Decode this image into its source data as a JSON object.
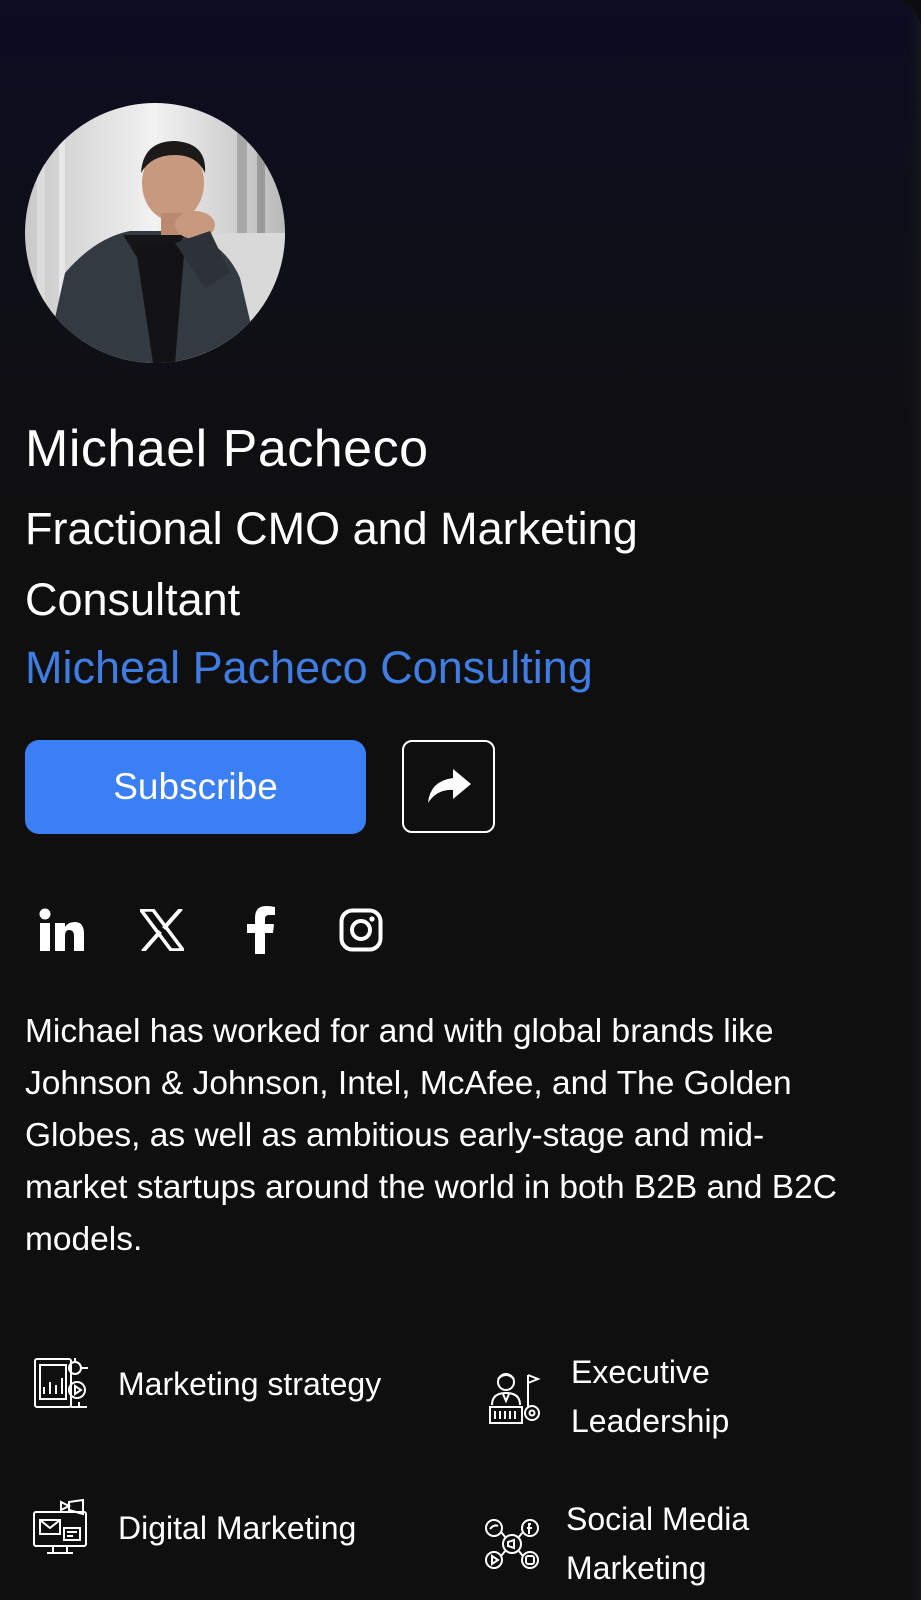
{
  "profile": {
    "name": "Michael Pacheco",
    "title": "Fractional CMO and Marketing Consultant",
    "company": "Micheal Pacheco Consulting",
    "bio": "Michael has worked for and with global brands like Johnson & Johnson, Intel, McAfee, and The Golden Globes, as well as ambitious early-stage and mid-market startups around the world in both B2B and B2C models."
  },
  "actions": {
    "subscribe_label": "Subscribe",
    "share_icon": "share-arrow-icon"
  },
  "social": [
    {
      "network": "LinkedIn",
      "icon": "linkedin-icon"
    },
    {
      "network": "X",
      "icon": "x-icon"
    },
    {
      "network": "Facebook",
      "icon": "facebook-icon"
    },
    {
      "network": "Instagram",
      "icon": "instagram-icon"
    }
  ],
  "skills": [
    {
      "label": "Marketing strategy",
      "icon": "marketing-strategy-icon"
    },
    {
      "label": "Executive Leadership",
      "icon": "executive-leadership-icon"
    },
    {
      "label": "Digital Marketing",
      "icon": "digital-marketing-icon"
    },
    {
      "label": "Social Media Marketing",
      "icon": "social-media-icon"
    }
  ],
  "colors": {
    "accent": "#3b7ff5",
    "link": "#3f7de4",
    "background": "#0f0f10"
  }
}
